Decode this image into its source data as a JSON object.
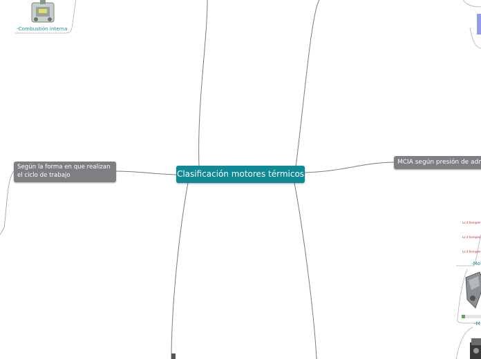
{
  "central": {
    "label": "Clasificación motores térmicos"
  },
  "left_topic": {
    "label": "Según la forma en que realizan el ciclo de trabajo"
  },
  "right_topic": {
    "label": "MCIA según presión de adm"
  },
  "top_left_label": "-Combustión interna",
  "right_mid_label": "-Mot",
  "right_low_label": "-M",
  "tiny_red_labels": [
    "Lo 4 tiempos",
    "Lo 4 tiempos",
    "Lo 4 tiempos"
  ],
  "colors": {
    "central": "#0e8a96",
    "topic": "#7d7f82",
    "connector": "#7a7a7a",
    "label_teal": "#1a8f9c",
    "red_note": "#cc2a2a"
  },
  "icons": [
    "engine-icon",
    "engine-block-icon",
    "piston-icon"
  ]
}
